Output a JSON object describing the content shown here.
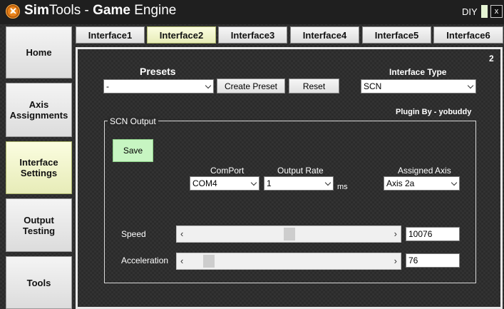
{
  "app": {
    "title_sim": "Sim",
    "title_tools": "Tools - ",
    "title_game": "Game",
    "title_engine": " Engine",
    "mode": "DIY",
    "close": "x"
  },
  "sidebar": {
    "items": [
      {
        "label": "Home"
      },
      {
        "label": "Axis Assignments"
      },
      {
        "label": "Interface Settings",
        "active": true
      },
      {
        "label": "Output Testing"
      },
      {
        "label": "Tools"
      }
    ]
  },
  "tabs": [
    {
      "label": "Interface1"
    },
    {
      "label": "Interface2",
      "active": true
    },
    {
      "label": "Interface3"
    },
    {
      "label": "Interface4"
    },
    {
      "label": "Interface5"
    },
    {
      "label": "Interface6"
    }
  ],
  "panel": {
    "number": "2",
    "presets_label": "Presets",
    "preset_value": "-",
    "create_preset": "Create Preset",
    "reset": "Reset",
    "interface_type_label": "Interface Type",
    "interface_type_value": "SCN",
    "plugin_by": "Plugin By - yobuddy"
  },
  "output": {
    "group_title": "SCN Output",
    "save": "Save",
    "comport_label": "ComPort",
    "comport_value": "COM4",
    "rate_label": "Output Rate",
    "rate_value": "1",
    "rate_unit": "ms",
    "axis_label": "Assigned Axis",
    "axis_value": "Axis 2a",
    "speed_label": "Speed",
    "speed_value": "10076",
    "accel_label": "Acceleration",
    "accel_value": "76"
  },
  "colors": {
    "active_tab": "#e7ecb8",
    "save_green": "#c7f5c2"
  }
}
